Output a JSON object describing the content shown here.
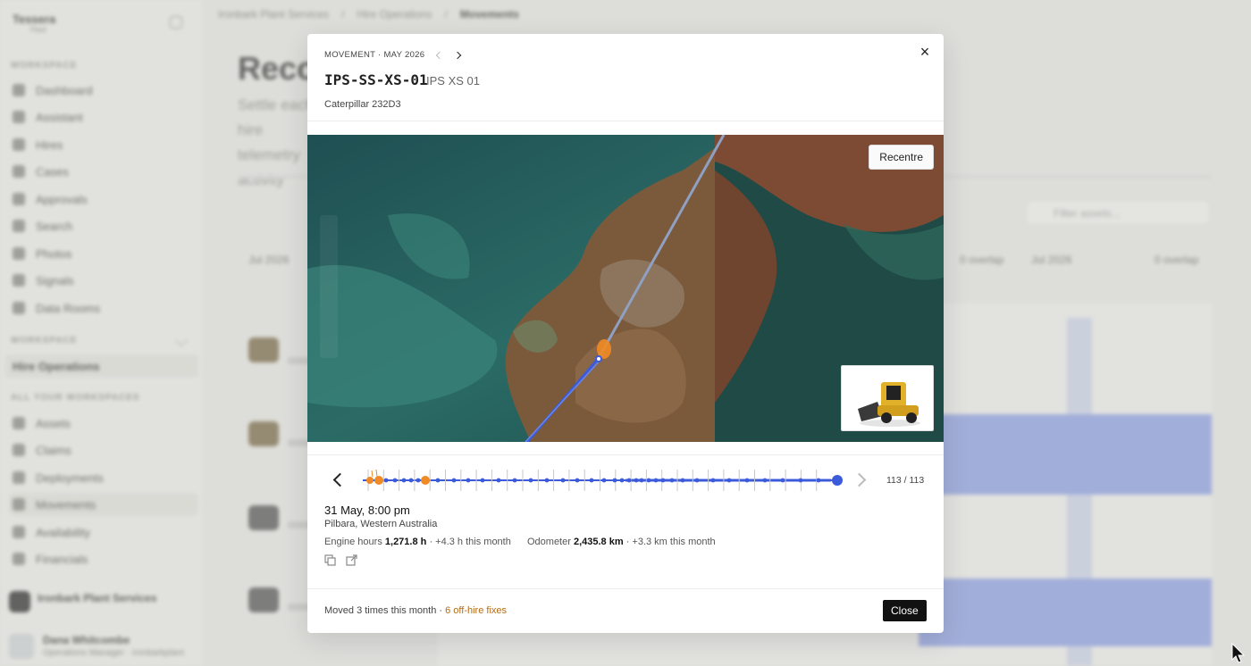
{
  "background": {
    "brand": "Tessera",
    "brand_sub": "Fleet",
    "sections": [
      "WORKSPACE",
      "WORKSPACE",
      "ALL YOUR WORKSPACES"
    ],
    "nav_top": [
      "Dashboard",
      "Assistant",
      "Hires",
      "Cases",
      "Approvals",
      "Search",
      "Photos",
      "Signals",
      "Data Rooms"
    ],
    "workspace_active": "Hire Operations",
    "nav_bottom": [
      "Assets",
      "Claims",
      "Deployments",
      "Movements",
      "Availability",
      "Financials"
    ],
    "org_name": "Ironbark Plant Services",
    "user_name": "Dana Whitcombe",
    "user_email": "Operations Manager · ironbarkplant",
    "breadcrumb": [
      "Ironbark Plant Services",
      "Hire Operations",
      "Movements"
    ],
    "page_title": "Recon",
    "page_desc": "Settle each hire telemetry activity",
    "filter_placeholder": "Filter assets...",
    "col_labels": [
      "Jul 2026",
      "0 overlap",
      "Jul 2026",
      "0 overlap"
    ]
  },
  "modal": {
    "eyebrow": "MOVEMENT · MAY 2026",
    "asset_code": "IPS-SS-XS-01",
    "asset_name": "IPS XS 01",
    "model": "Caterpillar 232D3",
    "recentre_label": "Recentre",
    "timeline_count": "113 / 113",
    "timeline_position": {
      "current": 113,
      "total": 113
    },
    "event": {
      "date": "31 May, 8:00 pm",
      "location": "Pilbara, Western Australia",
      "engine_label": "Engine hours",
      "engine_value": "1,271.8 h",
      "engine_delta": "· +4.3 h this month",
      "odo_label": "Odometer",
      "odo_value": "2,435.8 km",
      "odo_delta": "· +3.3 km this month"
    },
    "footer_text": "Moved 3 times this month ·",
    "footer_highlight": "6 off-hire fixes",
    "close_label": "Close"
  },
  "colors": {
    "accent_blue": "#3b5bdb",
    "marker_orange": "#f08a24",
    "highlight_orange": "#b26b16"
  }
}
